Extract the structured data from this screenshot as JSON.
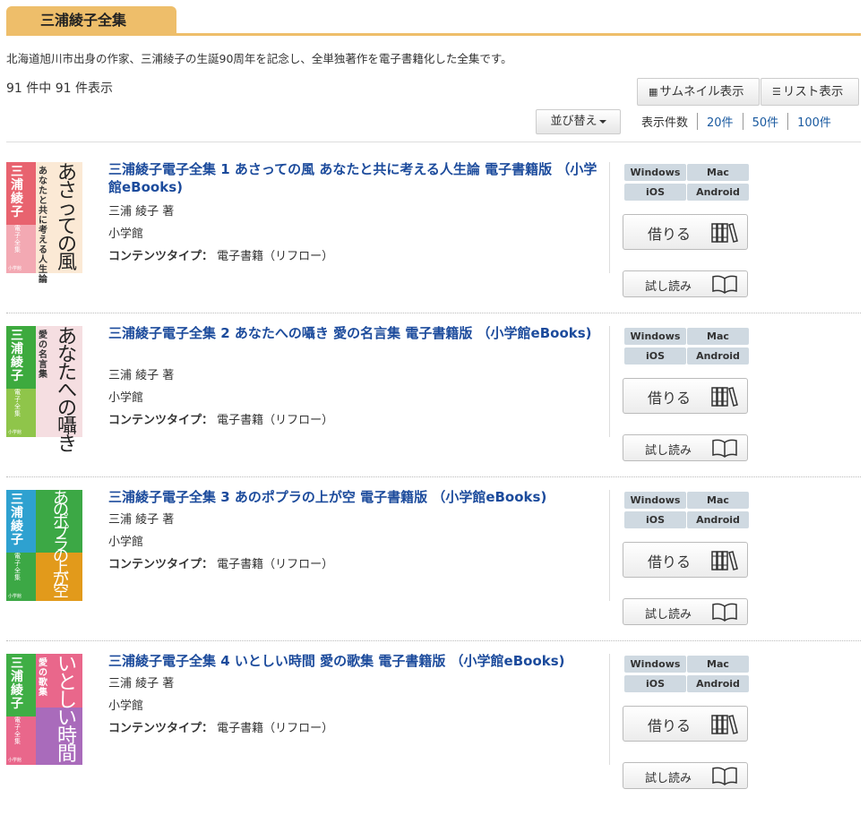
{
  "header": {
    "title": "三浦綾子全集",
    "description": "北海道旭川市出身の作家、三浦綾子の生誕90周年を記念し、全単独著作を電子書籍化した全集です。",
    "result_count": "91 件中 91 件表示"
  },
  "view": {
    "thumbnail_label": "サムネイル表示",
    "list_label": "リスト表示"
  },
  "sort": {
    "label": "並び替え"
  },
  "per_page": {
    "label": "表示件数",
    "options": [
      "20件",
      "50件",
      "100件"
    ]
  },
  "books": [
    {
      "title": "三浦綾子電子全集 1 あさっての風 あなたと共に考える人生論 電子書籍版 （小学館eBooks)",
      "author": "三浦 綾子 著",
      "publisher": "小学館",
      "content_type_label": "コンテンツタイプ：",
      "content_type": "電子書籍（リフロー）",
      "cover": {
        "author": "三浦綾子",
        "series": "電子全集",
        "publisher": "小学館",
        "main": "あさっての風",
        "sub": "あなたと共に考える人生論",
        "colors": [
          "#e8636f",
          "#f3a9b3",
          "#fbe9d5"
        ]
      }
    },
    {
      "title": "三浦綾子電子全集 2 あなたへの囁き 愛の名言集 電子書籍版 （小学館eBooks)",
      "author": "三浦 綾子 著",
      "publisher": "小学館",
      "content_type_label": "コンテンツタイプ：",
      "content_type": "電子書籍（リフロー）",
      "cover": {
        "author": "三浦綾子",
        "series": "電子全集",
        "publisher": "小学館",
        "main": "あなたへの囁き",
        "sub": "愛の名言集",
        "colors": [
          "#3daa3e",
          "#8fc54a",
          "#f5dee1"
        ]
      }
    },
    {
      "title": "三浦綾子電子全集 3 あのポプラの上が空 電子書籍版 （小学館eBooks)",
      "author": "三浦 綾子 著",
      "publisher": "小学館",
      "content_type_label": "コンテンツタイプ：",
      "content_type": "電子書籍（リフロー）",
      "cover": {
        "author": "三浦綾子",
        "series": "電子全集",
        "publisher": "小学館",
        "main": "あのポプラの上が空",
        "sub": "",
        "colors": [
          "#2ea1d0",
          "#3ca845",
          "#e29a1b"
        ]
      }
    },
    {
      "title": "三浦綾子電子全集 4 いとしい時間 愛の歌集 電子書籍版 （小学館eBooks)",
      "author": "三浦 綾子 著",
      "publisher": "小学館",
      "content_type_label": "コンテンツタイプ：",
      "content_type": "電子書籍（リフロー）",
      "cover": {
        "author": "三浦綾子",
        "series": "電子全集",
        "publisher": "小学館",
        "main": "いとしい時間",
        "sub": "愛の歌集",
        "colors": [
          "#3fae45",
          "#e9678b",
          "#a96bbb"
        ]
      }
    }
  ],
  "platforms": [
    "Windows",
    "Mac",
    "iOS",
    "Android"
  ],
  "actions": {
    "borrow_label": "借りる",
    "trial_label": "試し読み"
  }
}
